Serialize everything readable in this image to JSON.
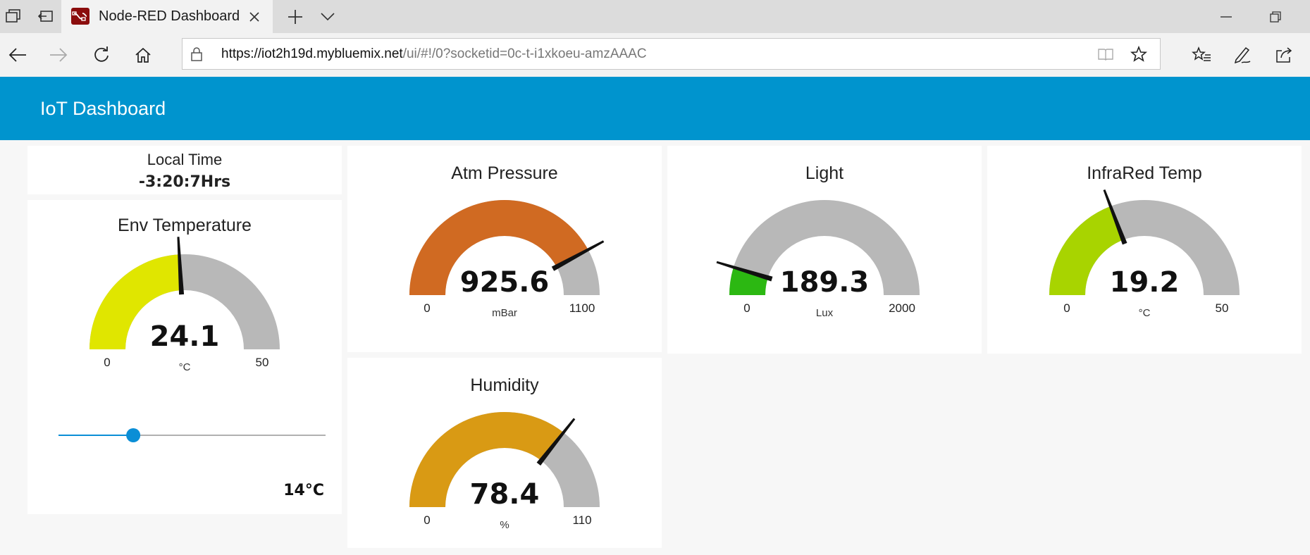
{
  "browser": {
    "tab_title": "Node-RED Dashboard",
    "url_host": "https://iot2h19d.mybluemix.net",
    "url_path": "/ui/#!/0?socketid=0c-t-i1xkoeu-amzAAAC"
  },
  "dashboard": {
    "title": "IoT Dashboard",
    "local_time": {
      "label": "Local Time",
      "value": "-3:20:7Hrs"
    },
    "slider": {
      "value": 14,
      "min": 0,
      "max": 50,
      "readout": "14°C",
      "color": "#0a8ed6"
    }
  },
  "gauges": {
    "env_temp": {
      "title": "Env Temperature",
      "value": 24.1,
      "value_text": "24.1",
      "min": 0,
      "max": 50,
      "min_text": "0",
      "max_text": "50",
      "unit": "°C",
      "color": "#e0e600"
    },
    "atm_pressure": {
      "title": "Atm Pressure",
      "value": 925.6,
      "value_text": "925.6",
      "min": 0,
      "max": 1100,
      "min_text": "0",
      "max_text": "1100",
      "unit": "mBar",
      "color": "#d06a22"
    },
    "humidity": {
      "title": "Humidity",
      "value": 78.4,
      "value_text": "78.4",
      "min": 0,
      "max": 110,
      "min_text": "0",
      "max_text": "110",
      "unit": "%",
      "color": "#d99a14"
    },
    "light": {
      "title": "Light",
      "value": 189.3,
      "value_text": "189.3",
      "min": 0,
      "max": 2000,
      "min_text": "0",
      "max_text": "2000",
      "unit": "Lux",
      "color": "#2cb812"
    },
    "infrared_temp": {
      "title": "InfraRed Temp",
      "value": 19.2,
      "value_text": "19.2",
      "min": 0,
      "max": 50,
      "min_text": "0",
      "max_text": "50",
      "unit": "°C",
      "color": "#a8d400"
    }
  },
  "colors": {
    "header": "#0094ce",
    "track": "#b8b8b8"
  }
}
